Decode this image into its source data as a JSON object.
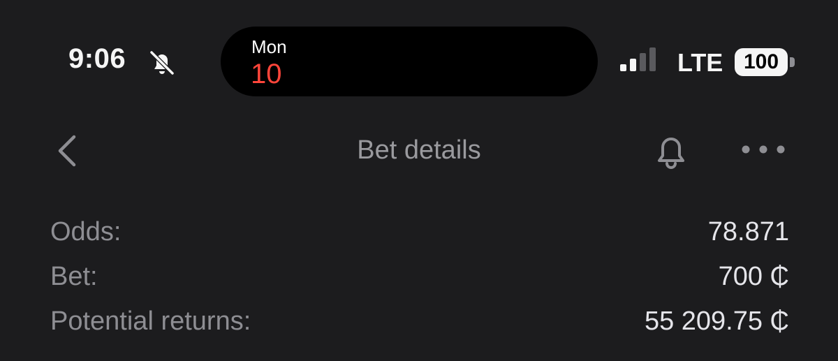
{
  "status_bar": {
    "time": "9:06",
    "mute_icon": "bell-slash-icon",
    "island": {
      "day": "Mon",
      "date": "10"
    },
    "signal_icon": "cellular-signal-icon",
    "network": "LTE",
    "battery": "100"
  },
  "nav": {
    "back_icon": "chevron-left-icon",
    "title": "Bet details",
    "bell_icon": "bell-icon",
    "more_icon": "more-horizontal-icon"
  },
  "details": {
    "odds_label": "Odds:",
    "odds_value": "78.871",
    "bet_label": "Bet:",
    "bet_value": "700 ₵",
    "returns_label": "Potential returns:",
    "returns_value": "55 209.75 ₵"
  },
  "colors": {
    "background": "#1c1c1e",
    "label": "#8e8e93",
    "value": "#e5e5ea",
    "date_accent": "#ff453a"
  }
}
